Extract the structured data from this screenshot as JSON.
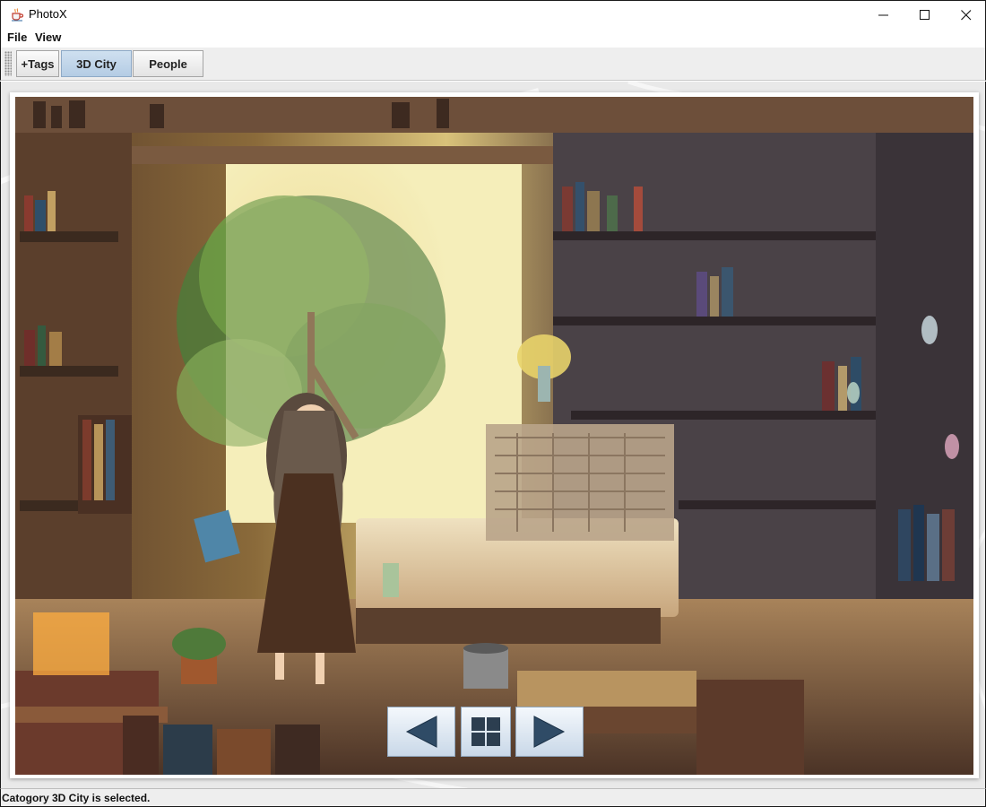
{
  "window": {
    "title": "PhotoX",
    "app_icon": "java-cup-icon",
    "controls": [
      "minimize-icon",
      "maximize-icon",
      "close-icon"
    ]
  },
  "menu": {
    "items": [
      {
        "label": "File"
      },
      {
        "label": "View"
      }
    ]
  },
  "toolbar": {
    "buttons": [
      {
        "label": "+Tags",
        "selected": false
      },
      {
        "label": "3D City",
        "selected": true
      },
      {
        "label": "People",
        "selected": false
      }
    ],
    "selected_color": "#b9cfe6"
  },
  "viewer": {
    "image": "anime-illustration-library-room",
    "navigation": [
      {
        "icon": "arrow-left-icon"
      },
      {
        "icon": "grid-icon"
      },
      {
        "icon": "arrow-right-icon"
      }
    ]
  },
  "status": {
    "text": "Catogory 3D City is selected."
  }
}
